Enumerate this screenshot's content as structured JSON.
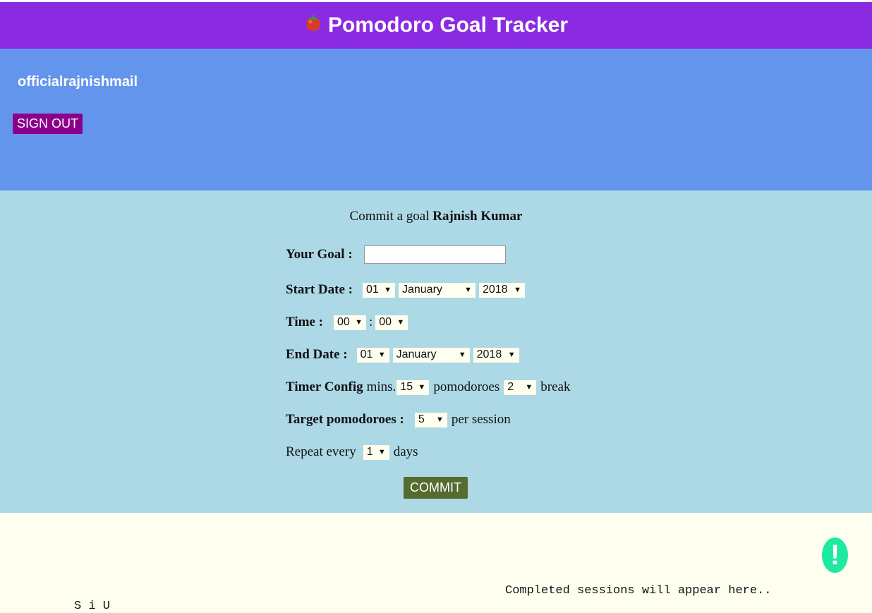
{
  "app": {
    "title": "Pomodoro Goal Tracker",
    "logo_icon": "tomato-icon"
  },
  "user": {
    "username": "officialrajnishmail",
    "signout_label": "SIGN OUT"
  },
  "form": {
    "heading_prefix": "Commit a goal",
    "heading_name": "Rajnish Kumar",
    "goal_label": "Your Goal :",
    "goal_value": "",
    "start_label": "Start Date :",
    "start_day": "01",
    "start_month": "January",
    "start_year": "2018",
    "time_label": "Time :",
    "time_hour": "00",
    "time_sep": ":",
    "time_minute": "00",
    "end_label": "End Date :",
    "end_day": "01",
    "end_month": "January",
    "end_year": "2018",
    "timer_label": "Timer Config",
    "timer_mins_text": "mins.",
    "timer_mins": "15",
    "timer_pomodoros_text": "pomodoroes",
    "timer_break": "2",
    "timer_break_text": "break",
    "target_label": "Target pomodoroes :",
    "target_value": "5",
    "target_suffix": "per session",
    "repeat_prefix": "Repeat every",
    "repeat_value": "1",
    "repeat_suffix": "days",
    "commit_label": "COMMIT"
  },
  "sessions": {
    "empty_text": "Completed sessions will appear here..",
    "partial_text": "S    i   U"
  },
  "alert": {
    "icon": "exclamation-icon",
    "glyph": "!"
  },
  "colors": {
    "header": "#8a2be2",
    "user_panel": "#6495ed",
    "form_panel": "#add8e6",
    "signout": "#8b008b",
    "commit": "#556b2f",
    "alert": "#1de9a0",
    "page": "#fffff0"
  }
}
